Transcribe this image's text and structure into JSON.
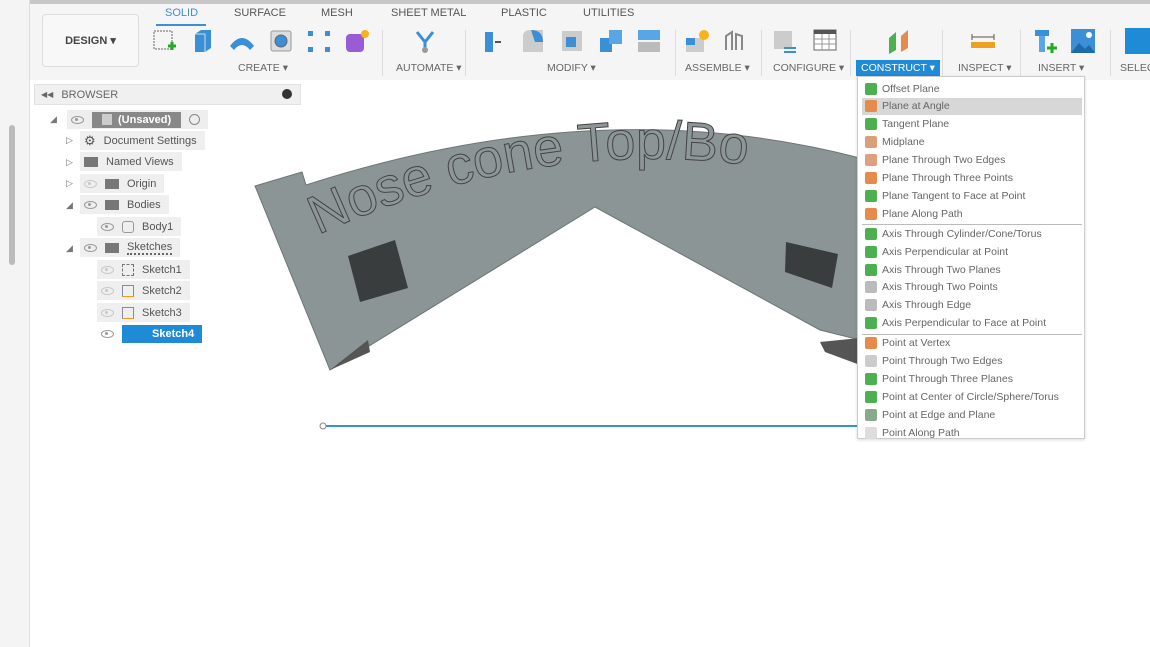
{
  "toolbar": {
    "workspace": "DESIGN ▾",
    "tabs": [
      "SOLID",
      "SURFACE",
      "MESH",
      "SHEET METAL",
      "PLASTIC",
      "UTILITIES"
    ],
    "active_tab": "SOLID",
    "groups": [
      "CREATE ▾",
      "AUTOMATE ▾",
      "MODIFY ▾",
      "ASSEMBLE ▾",
      "CONFIGURE ▾",
      "CONSTRUCT ▾",
      "INSPECT ▾",
      "INSERT ▾",
      "SELEC"
    ],
    "active_group": "CONSTRUCT",
    "accent": "#1f8ad6"
  },
  "browser": {
    "title": "BROWSER",
    "items": [
      {
        "label": "(Unsaved)"
      },
      {
        "label": "Document Settings"
      },
      {
        "label": "Named Views"
      },
      {
        "label": "Origin"
      },
      {
        "label": "Bodies"
      },
      {
        "label": "Body1"
      },
      {
        "label": "Sketches"
      },
      {
        "label": "Sketch1"
      },
      {
        "label": "Sketch2"
      },
      {
        "label": "Sketch3"
      },
      {
        "label": "Sketch4"
      }
    ],
    "selected": "Sketch4"
  },
  "viewport": {
    "model_text": "Nose cone Top/Bo"
  },
  "construct_menu": {
    "planes": [
      "Offset Plane",
      "Plane at Angle",
      "Tangent Plane",
      "Midplane",
      "Plane Through Two Edges",
      "Plane Through Three Points",
      "Plane Tangent to Face at Point",
      "Plane Along Path"
    ],
    "axes": [
      "Axis Through Cylinder/Cone/Torus",
      "Axis Perpendicular at Point",
      "Axis Through Two Planes",
      "Axis Through Two Points",
      "Axis Through Edge",
      "Axis Perpendicular to Face at Point"
    ],
    "points": [
      "Point at Vertex",
      "Point Through Two Edges",
      "Point Through Three Planes",
      "Point at Center of Circle/Sphere/Torus",
      "Point at Edge and Plane",
      "Point Along Path"
    ],
    "highlighted": "Plane at Angle"
  }
}
